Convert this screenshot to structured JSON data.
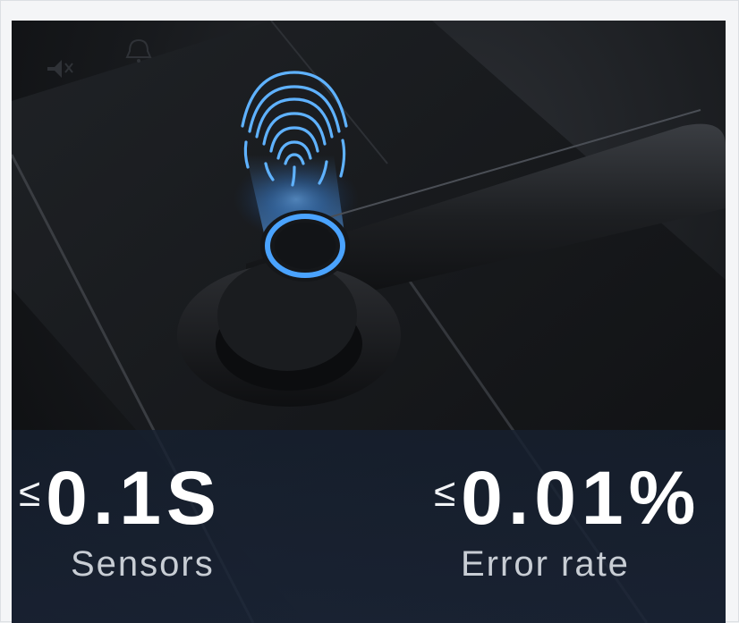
{
  "stats": {
    "left": {
      "symbol": "≤",
      "value": "0.1S",
      "caption": "Sensors"
    },
    "right": {
      "symbol": "≤",
      "value": "0.01%",
      "caption": "Error rate"
    }
  },
  "colors": {
    "accent_blue": "#4aa3ff",
    "overlay": "#1c2638",
    "caption_grey": "#c8cdd4"
  },
  "icons": [
    "mute-icon",
    "bell-icon",
    "fingerprint-icon"
  ]
}
